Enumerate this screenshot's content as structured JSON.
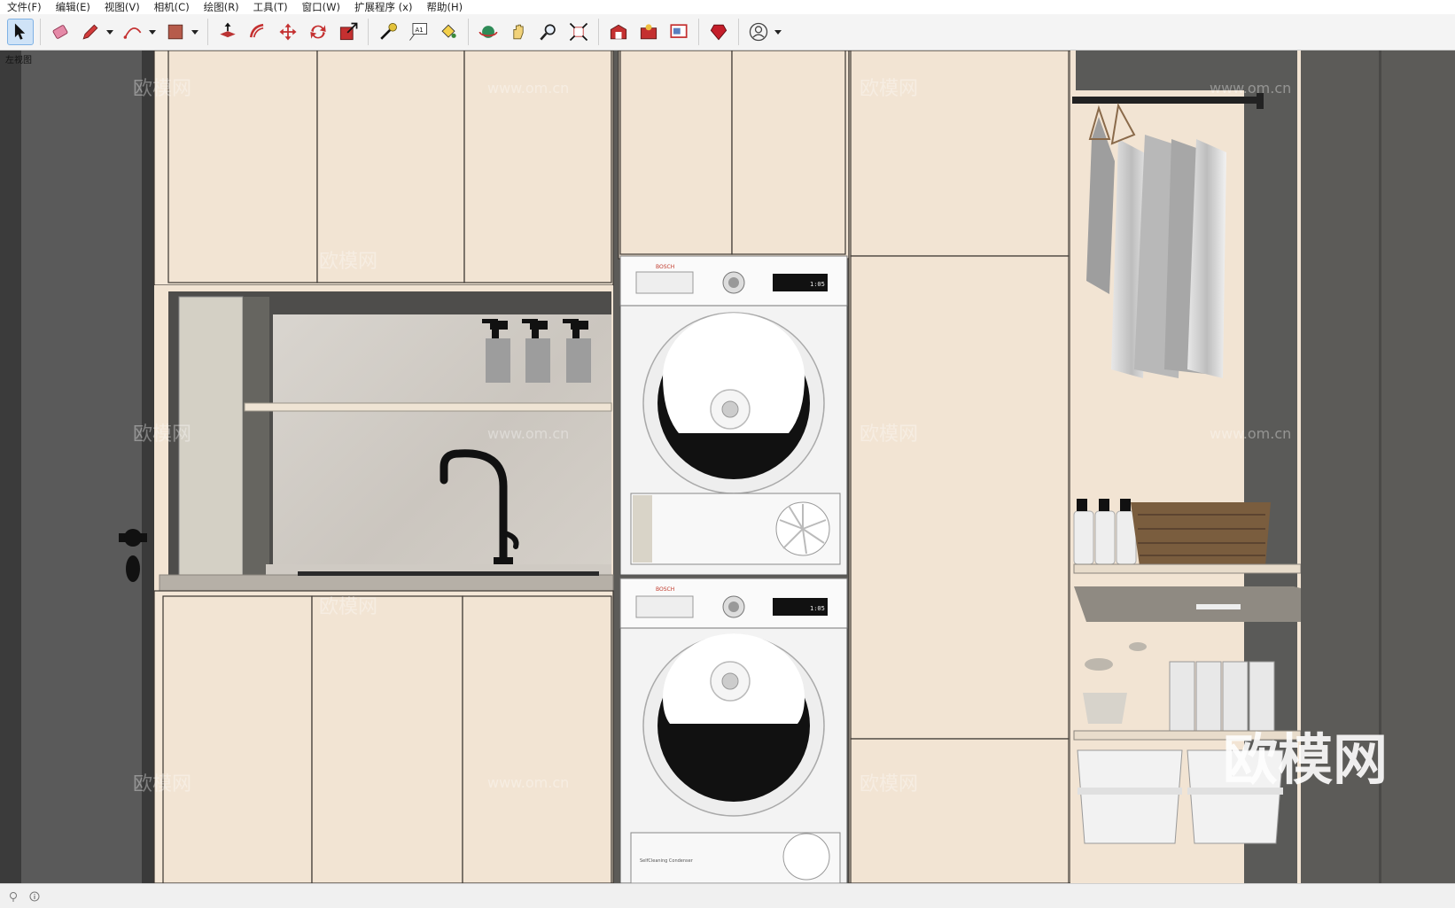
{
  "menu": [
    "文件(F)",
    "编辑(E)",
    "视图(V)",
    "相机(C)",
    "绘图(R)",
    "工具(T)",
    "窗口(W)",
    "扩展程序 (x)",
    "帮助(H)"
  ],
  "toolbar": {
    "groups": [
      [
        {
          "icon": "select-arrow-icon",
          "active": true
        }
      ],
      [
        {
          "icon": "eraser-icon"
        },
        {
          "icon": "pencil-icon",
          "dropdown": true
        },
        {
          "icon": "arc-icon",
          "dropdown": true
        },
        {
          "icon": "rectangle-shape-icon",
          "dropdown": true
        }
      ],
      [
        {
          "icon": "push-pull-icon"
        },
        {
          "icon": "offset-icon"
        },
        {
          "icon": "move-icon"
        },
        {
          "icon": "rotate-icon"
        },
        {
          "icon": "scale-icon"
        }
      ],
      [
        {
          "icon": "tape-measure-icon"
        },
        {
          "icon": "text-icon"
        },
        {
          "icon": "paint-bucket-icon"
        }
      ],
      [
        {
          "icon": "orbit-icon"
        },
        {
          "icon": "pan-hand-icon"
        },
        {
          "icon": "zoom-icon"
        },
        {
          "icon": "zoom-extents-icon"
        }
      ],
      [
        {
          "icon": "warehouse-icon"
        },
        {
          "icon": "extension-warehouse-icon"
        },
        {
          "icon": "layout-icon"
        }
      ],
      [
        {
          "icon": "ruby-console-icon"
        }
      ],
      [
        {
          "icon": "user-account-icon",
          "dropdown": true
        }
      ]
    ]
  },
  "scene": {
    "label": "左视图",
    "washer_brand": "BOSCH",
    "display_reading": "1:05",
    "dryer_caption": "SelfCleaning Condenser",
    "watermark_site": "www.om.cn",
    "watermark_brand": "欧模网"
  },
  "status": {
    "text": ""
  },
  "colors": {
    "cabinet": "#f2e4d3",
    "wall": "#5c5b58",
    "edge": "#3a3530",
    "black": "#111111"
  }
}
